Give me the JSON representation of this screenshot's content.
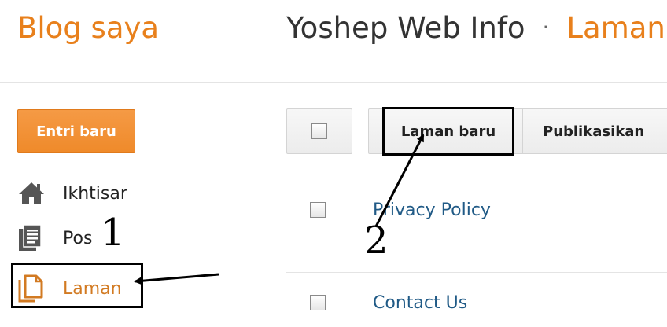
{
  "header": {
    "brand": "Blog saya",
    "blog_title": "Yoshep Web Info",
    "separator": "·",
    "crumb": "Laman"
  },
  "sidebar": {
    "new_post_button": "Entri baru",
    "items": [
      {
        "label": "Ikhtisar",
        "icon": "home-icon"
      },
      {
        "label": "Pos",
        "icon": "posts-icon"
      },
      {
        "label": "Laman",
        "icon": "pages-icon"
      }
    ]
  },
  "toolbar": {
    "new_page_button": "Laman baru",
    "publish_button": "Publikasikan"
  },
  "pages": [
    {
      "title": "Privacy Policy"
    },
    {
      "title": "Contact Us"
    }
  ],
  "annotations": {
    "step1": "1",
    "step2": "2"
  },
  "colors": {
    "accent": "#e8801c",
    "link": "#205a86",
    "annotation": "#000000"
  }
}
